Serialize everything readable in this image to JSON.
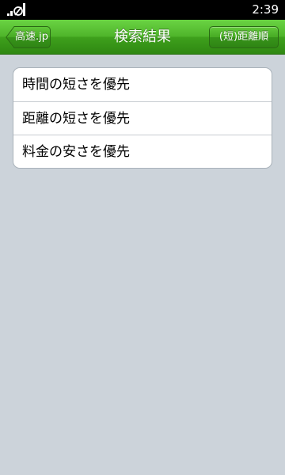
{
  "status_bar": {
    "time": "2:39",
    "icons": [
      "signal-icon"
    ]
  },
  "nav_bar": {
    "title": "検索結果",
    "back_label": "高速.jp",
    "sort_label": "(短)距離順"
  },
  "options": [
    {
      "label": "時間の短さを優先"
    },
    {
      "label": "距離の短さを優先"
    },
    {
      "label": "料金の安さを優先"
    }
  ],
  "colors": {
    "nav_green": "#4fb52b",
    "background": "#ccd3da",
    "status_bar": "#000000"
  }
}
